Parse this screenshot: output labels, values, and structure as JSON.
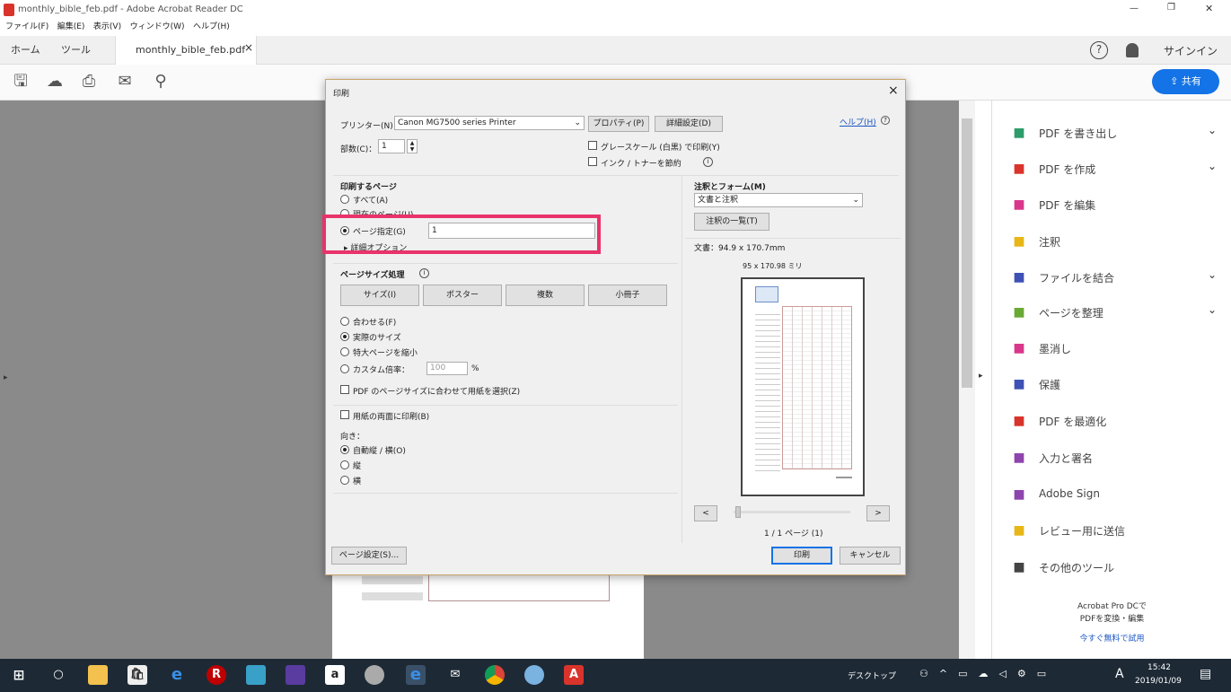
{
  "window": {
    "title": "monthly_bible_feb.pdf - Adobe Acrobat Reader DC",
    "minimize": "—",
    "restore": "❐",
    "close": "✕"
  },
  "menu": [
    "ファイル(F)",
    "編集(E)",
    "表示(V)",
    "ウィンドウ(W)",
    "ヘルプ(H)"
  ],
  "tabs": {
    "home": "ホーム",
    "tools": "ツール",
    "doc": "monthly_bible_feb.pdf",
    "doc_close": "×",
    "help": "?",
    "signin": "サインイン",
    "share": "共有"
  },
  "toolbar_icons": [
    "save-icon",
    "cloud-upload-icon",
    "print-icon",
    "mail-icon",
    "zoom-icon"
  ],
  "right_panel": {
    "items": [
      {
        "label": "PDF を書き出し",
        "icon": "export-pdf-icon",
        "color": "#2d9c6a",
        "chev": true
      },
      {
        "label": "PDF を作成",
        "icon": "create-pdf-icon",
        "color": "#d9342b",
        "chev": true
      },
      {
        "label": "PDF を編集",
        "icon": "edit-pdf-icon",
        "color": "#d9378b",
        "chev": false
      },
      {
        "label": "注釈",
        "icon": "comment-icon",
        "color": "#e8b717",
        "chev": false
      },
      {
        "label": "ファイルを結合",
        "icon": "combine-icon",
        "color": "#3f51b5",
        "chev": true
      },
      {
        "label": "ページを整理",
        "icon": "organize-icon",
        "color": "#6aa933",
        "chev": true
      },
      {
        "label": "墨消し",
        "icon": "redact-icon",
        "color": "#d9378b",
        "chev": false
      },
      {
        "label": "保護",
        "icon": "protect-icon",
        "color": "#3f51b5",
        "chev": false
      },
      {
        "label": "PDF を最適化",
        "icon": "optimize-icon",
        "color": "#d9342b",
        "chev": false
      },
      {
        "label": "入力と署名",
        "icon": "fill-sign-icon",
        "color": "#8e44ad",
        "chev": false
      },
      {
        "label": "Adobe Sign",
        "icon": "adobe-sign-icon",
        "color": "#8e44ad",
        "chev": false
      },
      {
        "label": "レビュー用に送信",
        "icon": "send-review-icon",
        "color": "#e8b717",
        "chev": false
      },
      {
        "label": "その他のツール",
        "icon": "more-tools-icon",
        "color": "#444444",
        "chev": false
      }
    ],
    "promo_line1": "Acrobat Pro DCで",
    "promo_line2": "PDFを変換・編集",
    "promo_link": "今すぐ無料で試用"
  },
  "dialog": {
    "title": "印刷",
    "close": "×",
    "printer_label": "プリンター(N)：",
    "printer_value": "Canon MG7500 series Printer",
    "properties_btn": "プロパティ(P)",
    "advanced_btn": "詳細設定(D)",
    "help_link": "ヘルプ(H)",
    "copies_label": "部数(C)：",
    "copies_value": "1",
    "grayscale": "グレースケール (白黒) で印刷(Y)",
    "save_ink": "インク / トナーを節約",
    "pages_section": "印刷するページ",
    "all": "すべて(A)",
    "current": "現在のページ(U)",
    "pages": "ページ指定(G)",
    "pages_value": "1",
    "more_options": "詳細オプション",
    "size_section": "ページサイズ処理",
    "size_btns": [
      "サイズ(I)",
      "ポスター",
      "複数",
      "小冊子"
    ],
    "fit": "合わせる(F)",
    "actual": "実際のサイズ",
    "shrink": "特大ページを縮小",
    "custom_scale": "カスタム倍率：",
    "custom_value": "100",
    "percent": "%",
    "choose_paper": "PDF のページサイズに合わせて用紙を選択(Z)",
    "duplex": "用紙の両面に印刷(B)",
    "orientation_label": "向き：",
    "orient_auto": "自動縦 / 横(O)",
    "orient_portrait": "縦",
    "orient_landscape": "横",
    "comments_section": "注釈とフォーム(M)",
    "comments_value": "文書と注釈",
    "comments_list_btn": "注釈の一覧(T)",
    "doc_size": "文書：94.9 x 170.7mm",
    "paper_size": "95 x 170.98 ミリ",
    "prev": "<",
    "next": ">",
    "page_count": "1 / 1 ページ (1)",
    "page_setup_btn": "ページ設定(S)...",
    "print_btn": "印刷",
    "cancel_btn": "キャンセル"
  },
  "taskbar": {
    "desktop_label": "デスクトップ",
    "ime": "A",
    "time": "15:42",
    "date": "2019/01/09"
  },
  "colors": {
    "accent": "#1473e6",
    "highlight": "#e8336b",
    "taskbar": "#1d2a36"
  }
}
